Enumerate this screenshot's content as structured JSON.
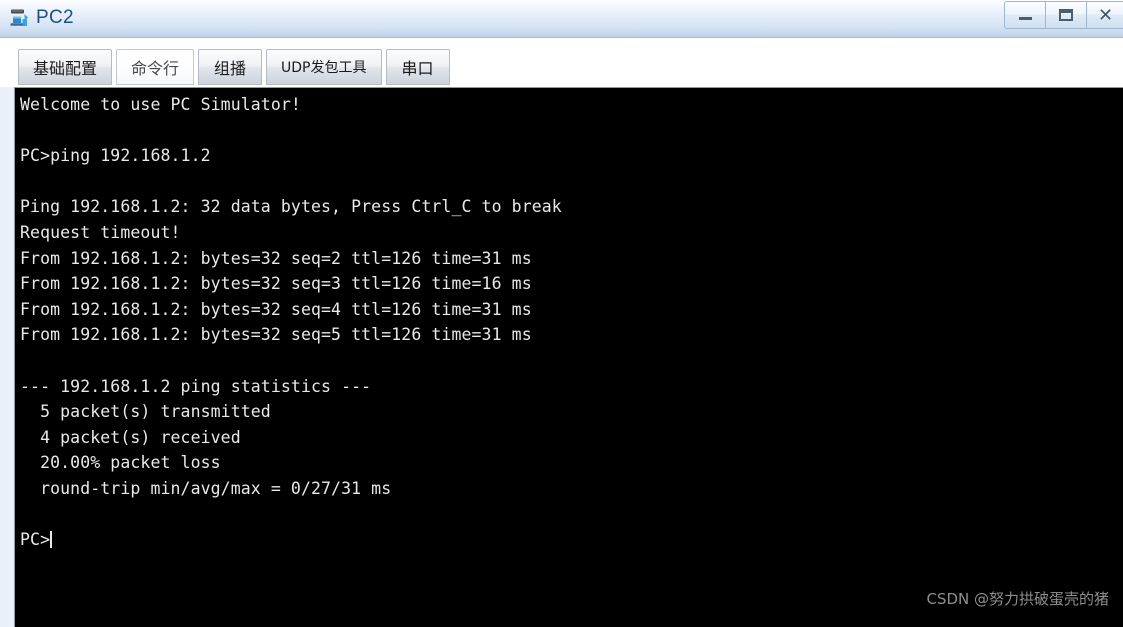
{
  "window": {
    "title": "PC2",
    "icon": "pc-device-icon",
    "controls": [
      {
        "name": "minimize-button",
        "glyph": "–",
        "label": "Minimize"
      },
      {
        "name": "maximize-button",
        "glyph": "▭",
        "label": "Maximize"
      },
      {
        "name": "close-button",
        "glyph": "✕",
        "label": "Close"
      }
    ],
    "titlebar_gradient_top": "#fdfeff",
    "titlebar_gradient_bottom": "#bfd0e6",
    "title_color": "#1f4e86"
  },
  "tabs": [
    {
      "label": "基础配置",
      "active": false,
      "small": false
    },
    {
      "label": "命令行",
      "active": true,
      "small": false
    },
    {
      "label": "组播",
      "active": false,
      "small": false
    },
    {
      "label": "UDP发包工具",
      "active": false,
      "small": true
    },
    {
      "label": "串口",
      "active": false,
      "small": false
    }
  ],
  "terminal": {
    "background": "#000000",
    "foreground": "#e9e9e9",
    "prompt": "PC>",
    "lines": [
      "Welcome to use PC Simulator!",
      "",
      "PC>ping 192.168.1.2",
      "",
      "Ping 192.168.1.2: 32 data bytes, Press Ctrl_C to break",
      "Request timeout!",
      "From 192.168.1.2: bytes=32 seq=2 ttl=126 time=31 ms",
      "From 192.168.1.2: bytes=32 seq=3 ttl=126 time=16 ms",
      "From 192.168.1.2: bytes=32 seq=4 ttl=126 time=31 ms",
      "From 192.168.1.2: bytes=32 seq=5 ttl=126 time=31 ms",
      "",
      "--- 192.168.1.2 ping statistics ---",
      "  5 packet(s) transmitted",
      "  4 packet(s) received",
      "  20.00% packet loss",
      "  round-trip min/avg/max = 0/27/31 ms",
      ""
    ],
    "cursor_line": "PC>"
  },
  "watermark": {
    "text": "CSDN @努力拱破蛋壳的猪",
    "color": "#8e8e8e"
  }
}
